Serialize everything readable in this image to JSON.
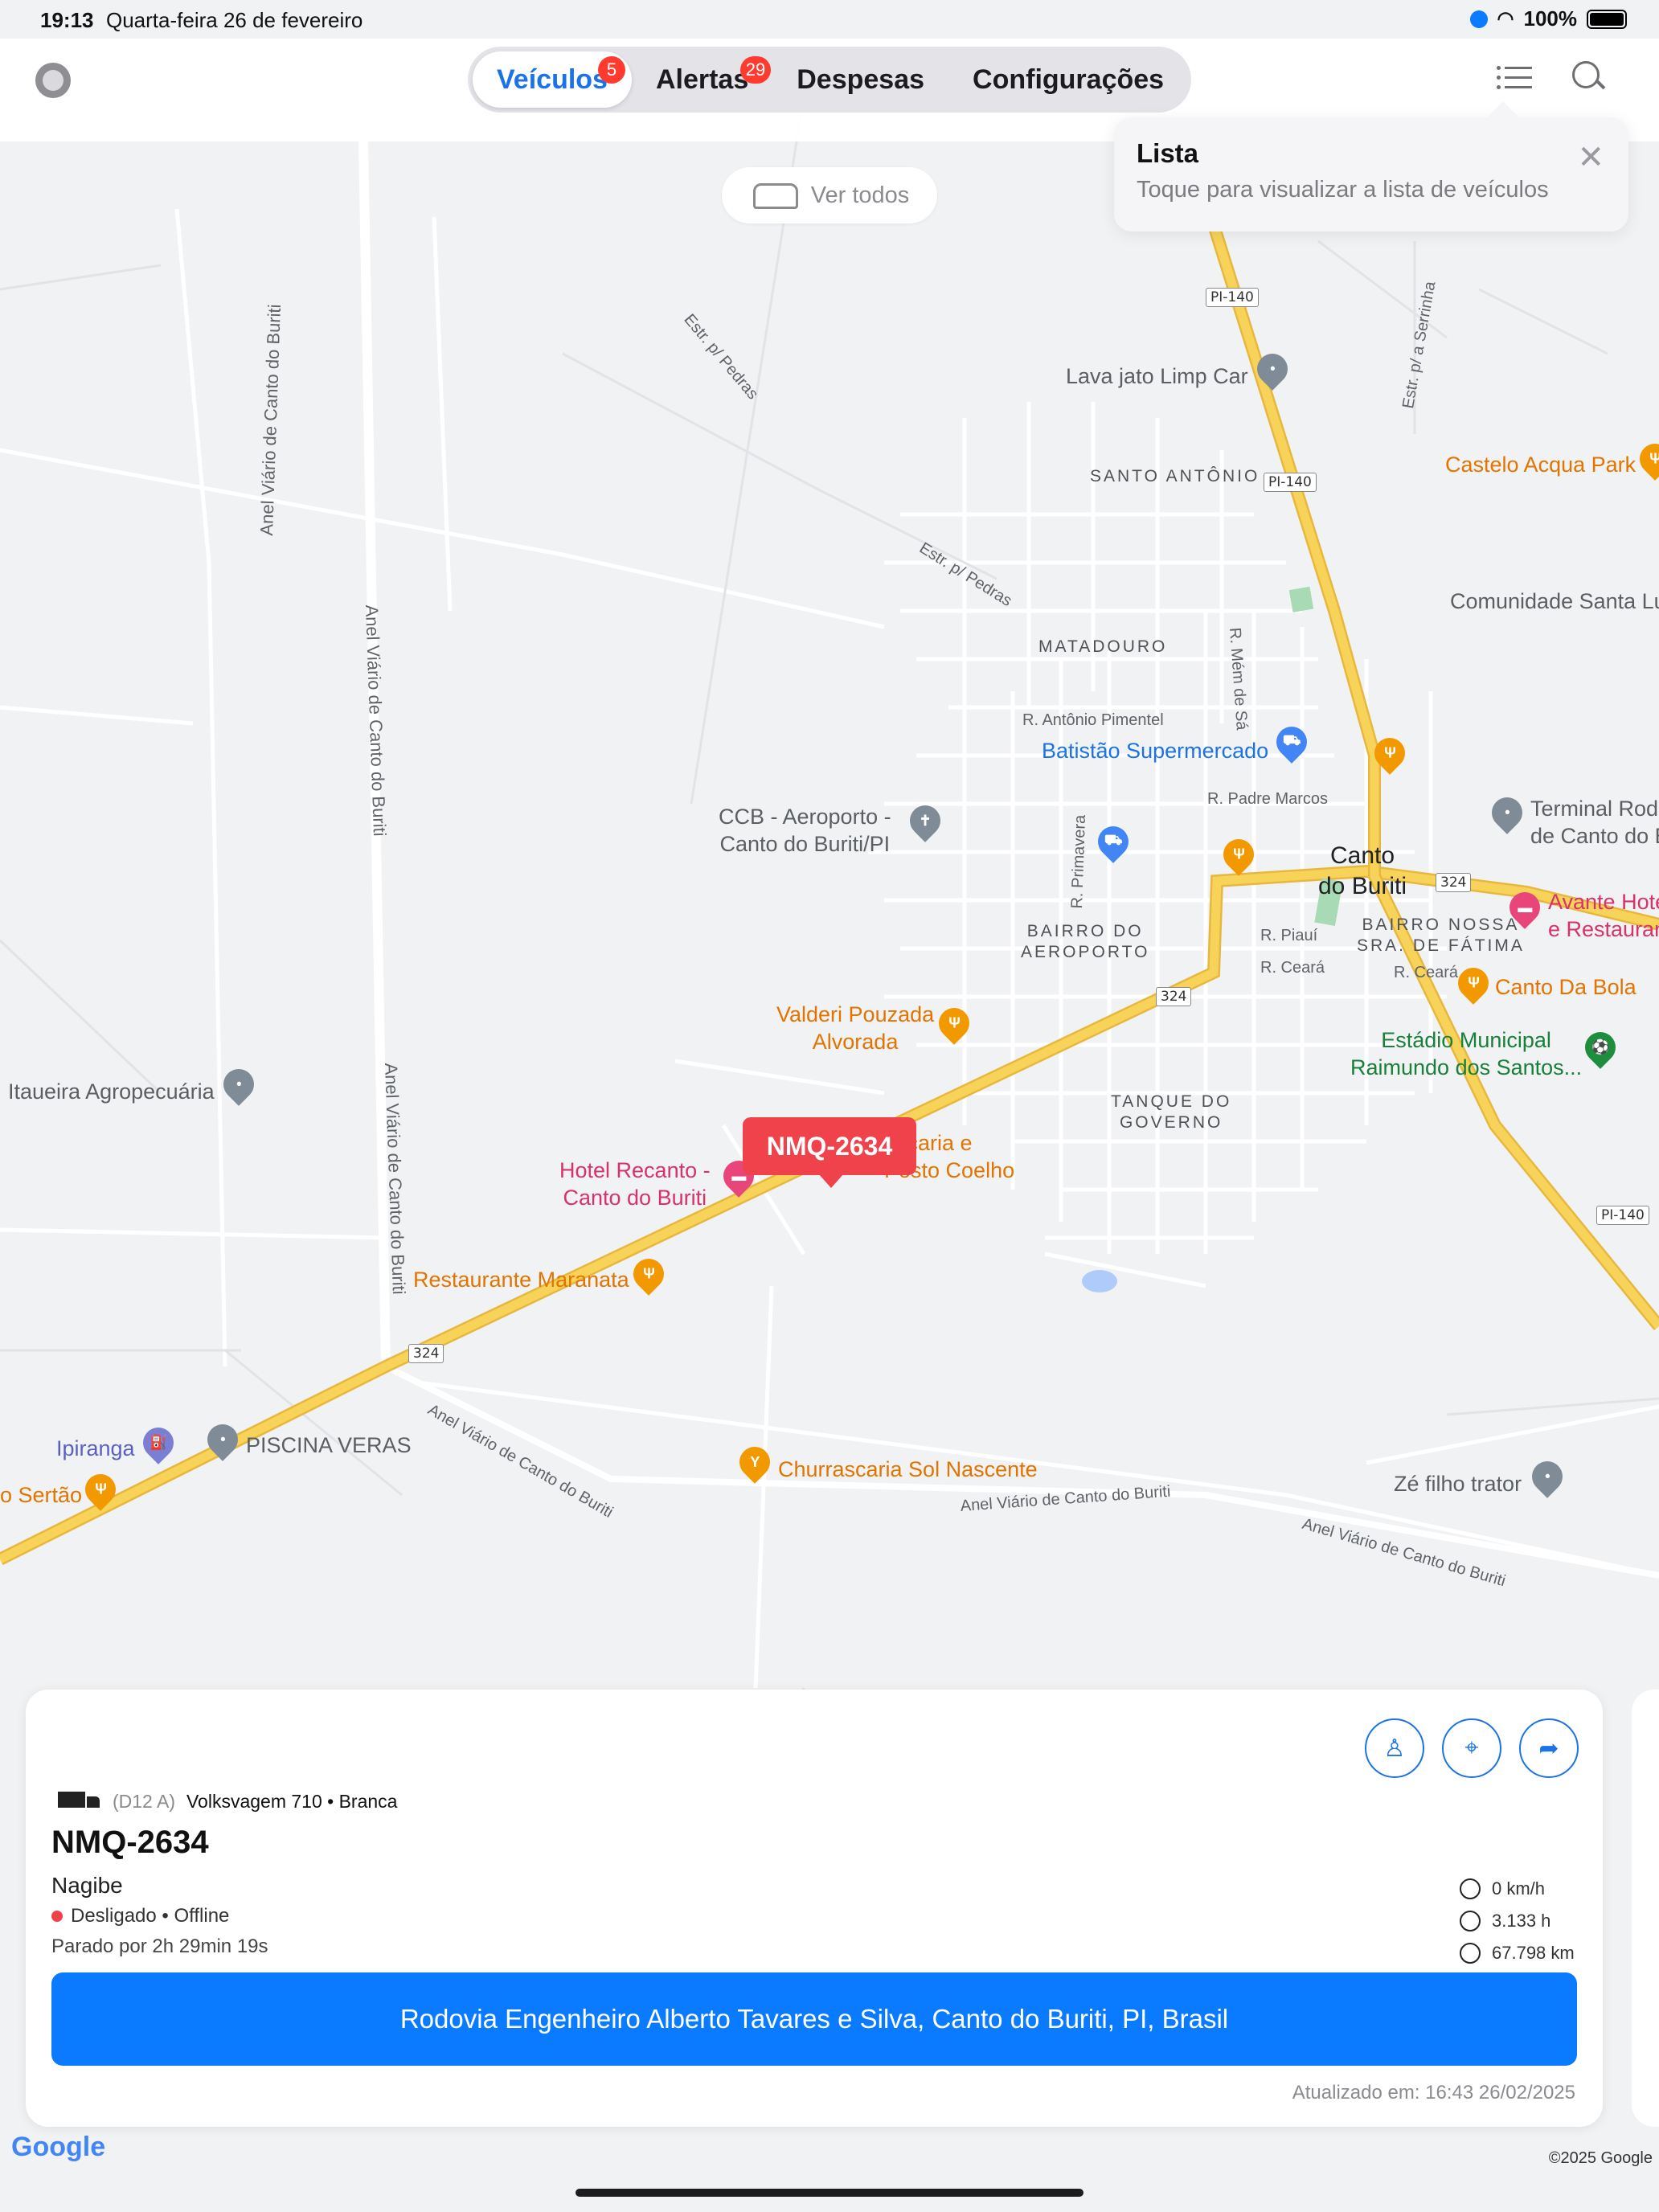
{
  "statusbar": {
    "time": "19:13",
    "date": "Quarta-feira 26 de fevereiro",
    "battery": "100%"
  },
  "nav": {
    "tabs": [
      {
        "label": "Veículos",
        "badge": "5"
      },
      {
        "label": "Alertas",
        "badge": "29"
      },
      {
        "label": "Despesas"
      },
      {
        "label": "Configurações"
      }
    ],
    "active_tab": "Veículos"
  },
  "tooltip": {
    "title": "Lista",
    "body": "Toque para visualizar a lista de veículos"
  },
  "ver_todos": "Ver todos",
  "map": {
    "labels": {
      "lava_jato": "Lava jato Limp Car",
      "santo_antonio": "SANTO ANTÔNIO",
      "castelo": "Castelo Acqua Park",
      "comunidade": "Comunidade Santa Lu",
      "matadouro": "MATADOURO",
      "antonio_pimentel": "R. Antônio Pimentel",
      "batistao": "Batistão Supermercado",
      "ccb": "CCB - Aeroporto -\nCanto do Buriti/PI",
      "padre_marcos": "R. Padre Marcos",
      "terminal": "Terminal Rodo\nde Canto do B",
      "canto_do_buriti": "Canto\ndo Buriti",
      "avante": "Avante Hote\ne Restauran",
      "bairro_aeroporto": "BAIRRO DO\nAEROPORTO",
      "bairro_fatima": "BAIRRO NOSSA\nSRA. DE FÁTIMA",
      "r_piaui": "R. Piauí",
      "r_ceara": "R. Ceará",
      "r_ceara_2": "R. Ceará",
      "canto_da_bola": "Canto Da Bola",
      "valderi": "Valderi Pouzada\nAlvorada",
      "estadio": "Estádio Municipal\nRaimundo dos Santos...",
      "tanque": "TANQUE DO\nGOVERNO",
      "itaueira": "Itaueira Agropecuária",
      "hotel_recanto": "Hotel Recanto -\nCanto do Buriti",
      "churrascaria_coelho": "ascaria e\nPosto Coelho",
      "maranata": "Restaurante Maranata",
      "ipiranga": "Ipiranga",
      "piscina": "PISCINA VERAS",
      "sertao": "o Sertão",
      "sol_nascente": "Churrascaria Sol Nascente",
      "ze_filho": "Zé filho trator",
      "anel_1": "Anel Viário de Canto do Buriti",
      "anel_2": "Anel Viário de Canto do Buriti",
      "anel_3": "Anel Viário de Canto do Buriti",
      "anel_4": "Anel Viário de Canto do Buriti",
      "anel_5": "Anel Viário de Canto do Buriti",
      "anel_6": "Anel Viário de Canto do Buriti",
      "estr_pedras_1": "Estr. p/ Pedras",
      "estr_pedras_2": "Estr. p/ Pedras",
      "estr_serrinha": "Estr. p/ a Serrinha",
      "r_primavera": "R. Primavera",
      "r_mem_de_sa": "R. Mém de Sá"
    },
    "shields": {
      "pi140_a": "PI-140",
      "pi140_b": "PI-140",
      "pi140_c": "PI-140",
      "r324_a": "324",
      "r324_b": "324",
      "r324_c": "324"
    }
  },
  "vehicle_marker": "NMQ-2634",
  "card": {
    "model_code": "(D12 A)",
    "model": "Volksvagem 710 • Branca",
    "plate": "NMQ-2634",
    "driver": "Nagibe",
    "status": "Desligado • Offline",
    "parked": "Parado por 2h 29min 19s",
    "speed": "0 km/h",
    "hours": "3.133 h",
    "odometer": "67.798 km",
    "address": "Rodovia Engenheiro Alberto Tavares e Silva, Canto do Buriti, PI, Brasil",
    "updated": "Atualizado em: 16:43 26/02/2025"
  },
  "footer": {
    "google": "Google",
    "copyright": "©2025 Google"
  },
  "colors": {
    "accent": "#1a73e8",
    "primary_button": "#0a7aff",
    "marker": "#f0424a",
    "road_yellow": "#f7d35a"
  }
}
